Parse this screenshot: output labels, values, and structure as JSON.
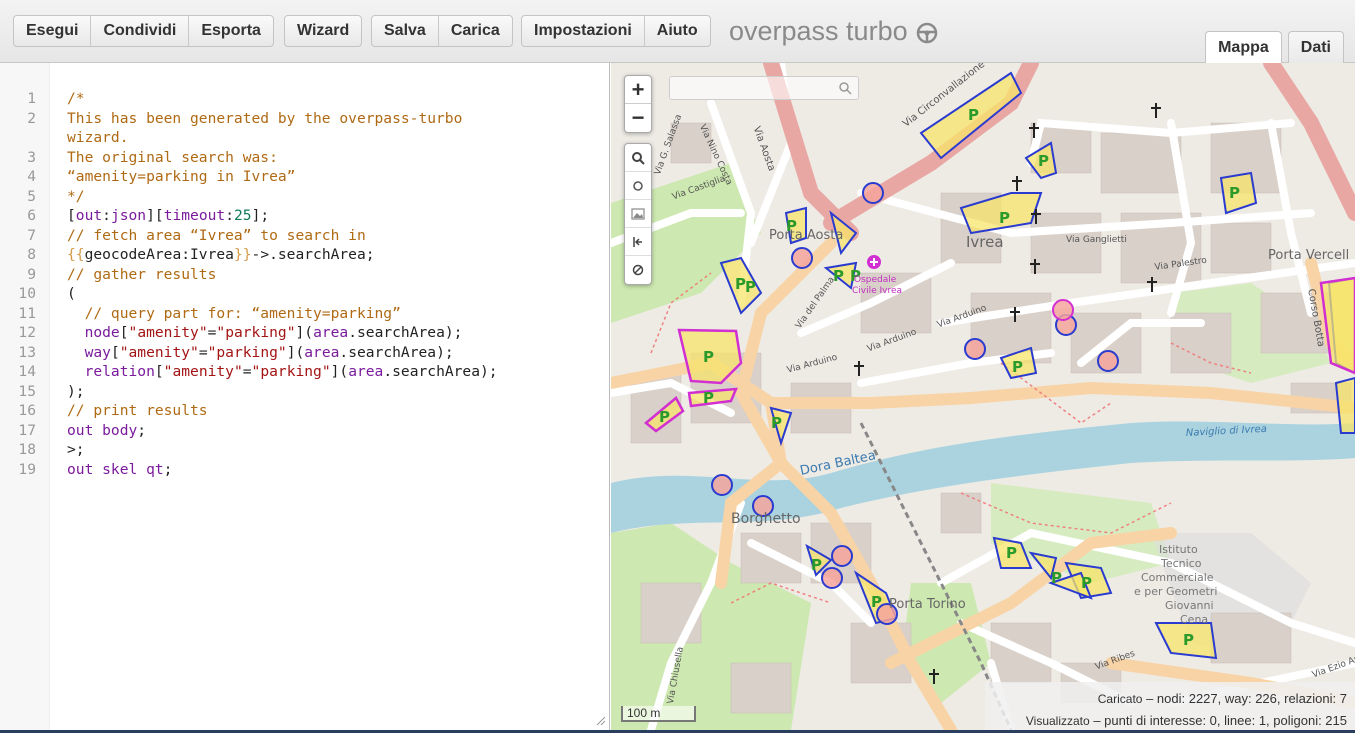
{
  "toolbar": {
    "run": "Esegui",
    "share": "Condividi",
    "export": "Esporta",
    "wizard": "Wizard",
    "save": "Salva",
    "load": "Carica",
    "settings": "Impostazioni",
    "help": "Aiuto",
    "brand": "overpass turbo",
    "brand_icon": "steering-wheel-icon"
  },
  "tabs": {
    "map": "Mappa",
    "data": "Dati",
    "active": "map"
  },
  "editor": {
    "lines": [
      {
        "n": "1",
        "parts": [
          [
            "/*",
            "comment"
          ]
        ]
      },
      {
        "n": "2",
        "parts": [
          [
            "This has been generated by the overpass-turbo",
            "comment"
          ]
        ]
      },
      {
        "n": "",
        "parts": [
          [
            "wizard.",
            "comment"
          ]
        ]
      },
      {
        "n": "3",
        "parts": [
          [
            "The original search was:",
            "comment"
          ]
        ]
      },
      {
        "n": "4",
        "parts": [
          [
            "“amenity=parking in Ivrea”",
            "comment"
          ]
        ]
      },
      {
        "n": "5",
        "parts": [
          [
            "*/",
            "comment"
          ]
        ]
      },
      {
        "n": "6",
        "parts": [
          [
            "[",
            "plain"
          ],
          [
            "out",
            "kw"
          ],
          [
            ":",
            "plain"
          ],
          [
            "json",
            "kw"
          ],
          [
            "][",
            "plain"
          ],
          [
            "timeout",
            "kw"
          ],
          [
            ":",
            "plain"
          ],
          [
            "25",
            "num"
          ],
          [
            "];",
            "plain"
          ]
        ]
      },
      {
        "n": "7",
        "parts": [
          [
            "// fetch area “Ivrea” to search in",
            "comment"
          ]
        ]
      },
      {
        "n": "8",
        "parts": [
          [
            "{{",
            "tmpl"
          ],
          [
            "geocodeArea:Ivrea",
            "plain"
          ],
          [
            "}}",
            "tmpl"
          ],
          [
            "->.searchArea;",
            "plain"
          ]
        ]
      },
      {
        "n": "9",
        "parts": [
          [
            "// gather results",
            "comment"
          ]
        ]
      },
      {
        "n": "10",
        "parts": [
          [
            "(",
            "plain"
          ]
        ]
      },
      {
        "n": "11",
        "parts": [
          [
            "  // query part for: “amenity=parking”",
            "comment"
          ]
        ]
      },
      {
        "n": "12",
        "parts": [
          [
            "  ",
            "plain"
          ],
          [
            "node",
            "kw"
          ],
          [
            "[",
            "plain"
          ],
          [
            "\"amenity\"",
            "str"
          ],
          [
            "=",
            "plain"
          ],
          [
            "\"parking\"",
            "str"
          ],
          [
            "](",
            "plain"
          ],
          [
            "area",
            "kw"
          ],
          [
            ".searchArea);",
            "plain"
          ]
        ]
      },
      {
        "n": "13",
        "parts": [
          [
            "  ",
            "plain"
          ],
          [
            "way",
            "kw"
          ],
          [
            "[",
            "plain"
          ],
          [
            "\"amenity\"",
            "str"
          ],
          [
            "=",
            "plain"
          ],
          [
            "\"parking\"",
            "str"
          ],
          [
            "](",
            "plain"
          ],
          [
            "area",
            "kw"
          ],
          [
            ".searchArea);",
            "plain"
          ]
        ]
      },
      {
        "n": "14",
        "parts": [
          [
            "  ",
            "plain"
          ],
          [
            "relation",
            "kw"
          ],
          [
            "[",
            "plain"
          ],
          [
            "\"amenity\"",
            "str"
          ],
          [
            "=",
            "plain"
          ],
          [
            "\"parking\"",
            "str"
          ],
          [
            "](",
            "plain"
          ],
          [
            "area",
            "kw"
          ],
          [
            ".searchArea);",
            "plain"
          ]
        ]
      },
      {
        "n": "15",
        "parts": [
          [
            ");",
            "plain"
          ]
        ]
      },
      {
        "n": "16",
        "parts": [
          [
            "// print results",
            "comment"
          ]
        ]
      },
      {
        "n": "17",
        "parts": [
          [
            "out body",
            "kw"
          ],
          [
            ";",
            "plain"
          ]
        ]
      },
      {
        "n": "18",
        "parts": [
          [
            ">;",
            "plain"
          ]
        ]
      },
      {
        "n": "19",
        "parts": [
          [
            "out skel qt",
            "kw"
          ],
          [
            ";",
            "plain"
          ]
        ]
      }
    ]
  },
  "map": {
    "zoom_in": "+",
    "zoom_out": "−",
    "scale": "100 m",
    "place_labels": {
      "ivrea": "Ivrea",
      "porta_aosta": "Porta Aosta",
      "borghetto": "Borghetto",
      "porta_torino": "Porta Torino",
      "porta_vercelli": "Porta Vercell",
      "ospedale": "Ospedale",
      "ospedale2": "Civile Ivrea",
      "naviglio": "Naviglio di Ivrea",
      "dora": "Dora Baltea",
      "istituto1": "Istituto",
      "istituto2": "Tecnico",
      "istituto3": "Commerciale",
      "istituto4": "e per Geometri",
      "istituto5": "Giovanni",
      "istituto6": "Cena"
    },
    "street_labels": {
      "circonvallazione": "Via Circonvallazione",
      "aosta": "Via Aosta",
      "salassa": "Via G. Salassa",
      "nino_costa": "Via Nino Costa",
      "castiglia": "Via Castiglia",
      "palma": "Via del Palma",
      "arduino1": "Via Arduino",
      "arduino2": "Via Arduino",
      "arduino3": "Via Arduino",
      "gaglietti": "Via Ganglietti",
      "palestro": "Via Palestro",
      "botta": "Corso Botta",
      "ribes": "Via Ribes",
      "chiusella": "Via Chiusella",
      "ezio": "Via Ezio An"
    },
    "stats": {
      "loaded_label": "Caricato",
      "loaded_value": "– nodi: 2227, way: 226, relazioni: 7",
      "shown_label": "Visualizzato",
      "shown_value": "– punti di interesse: 0, linee: 1, poligoni: 215"
    },
    "colors": {
      "background": "#eeebe5",
      "road_major": "#f8d3a6",
      "road_primary": "#e9a7a3",
      "water": "#aad3df",
      "park": "#cde8b0",
      "parking_fill": "#f7e46a",
      "parking_stroke": "#2a3bd0",
      "parking_alt_stroke": "#d12fd1",
      "poi_circle_fill": "#f4a49c"
    }
  }
}
